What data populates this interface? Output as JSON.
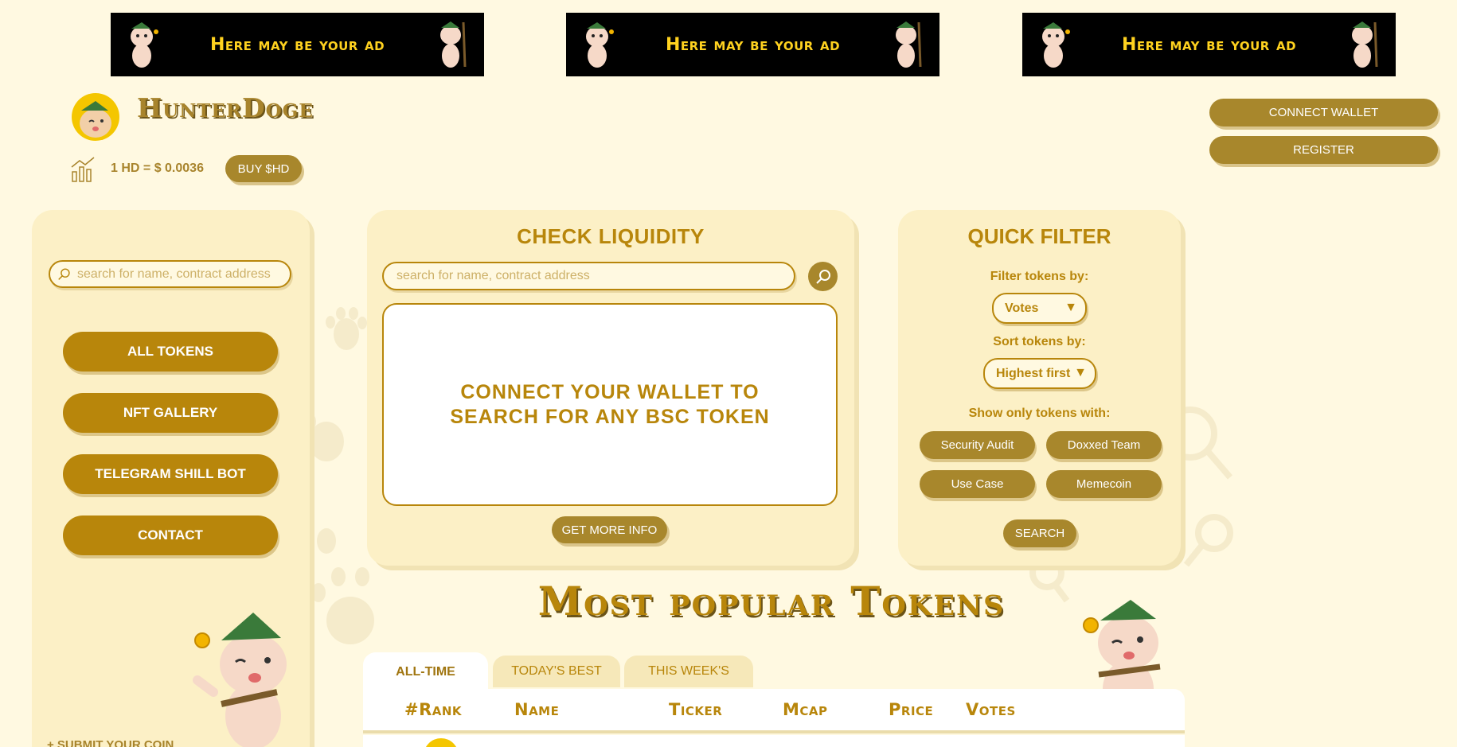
{
  "ads": [
    {
      "text": "Here may be your ad"
    },
    {
      "text": "Here may be your ad"
    },
    {
      "text": "Here may be your ad"
    }
  ],
  "header": {
    "brand": "HunterDoge",
    "price": "1 HD = $ 0.0036",
    "buy_label": "BUY $HD",
    "connect_label": "CONNECT WALLET",
    "register_label": "REGISTER"
  },
  "sidebar": {
    "search_placeholder": "search for name, contract address",
    "nav": [
      {
        "label": "ALL TOKENS"
      },
      {
        "label": "NFT GALLERY"
      },
      {
        "label": "TELEGRAM SHILL BOT"
      },
      {
        "label": "CONTACT"
      }
    ],
    "submit_label": "+ SUBMIT YOUR COIN"
  },
  "liquidity": {
    "title": "CHECK LIQUIDITY",
    "search_placeholder": "search for name, contract address",
    "message": "CONNECT YOUR WALLET TO SEARCH FOR ANY BSC TOKEN",
    "more_label": "GET MORE INFO"
  },
  "quick_filter": {
    "title": "QUICK FILTER",
    "filter_label": "Filter tokens by:",
    "filter_value": "Votes",
    "sort_label": "Sort tokens by:",
    "sort_value": "Highest first",
    "show_label": "Show only tokens with:",
    "chips": [
      {
        "label": "Security Audit"
      },
      {
        "label": "Doxxed Team"
      },
      {
        "label": "Use Case"
      },
      {
        "label": "Memecoin"
      }
    ],
    "search_label": "SEARCH"
  },
  "popular": {
    "title": "Most popular Tokens",
    "tabs": [
      {
        "label": "ALL-TIME"
      },
      {
        "label": "TODAY'S BEST"
      },
      {
        "label": "THIS WEEK'S"
      }
    ],
    "columns": [
      {
        "label": "#Rank"
      },
      {
        "label": "Name"
      },
      {
        "label": "Ticker"
      },
      {
        "label": "Mcap"
      },
      {
        "label": "Price"
      },
      {
        "label": "Votes"
      }
    ]
  },
  "colors": {
    "background": "#fff9e1",
    "accent": "#b8860b",
    "button": "#a8872c",
    "ad_text": "#ffd21f"
  }
}
